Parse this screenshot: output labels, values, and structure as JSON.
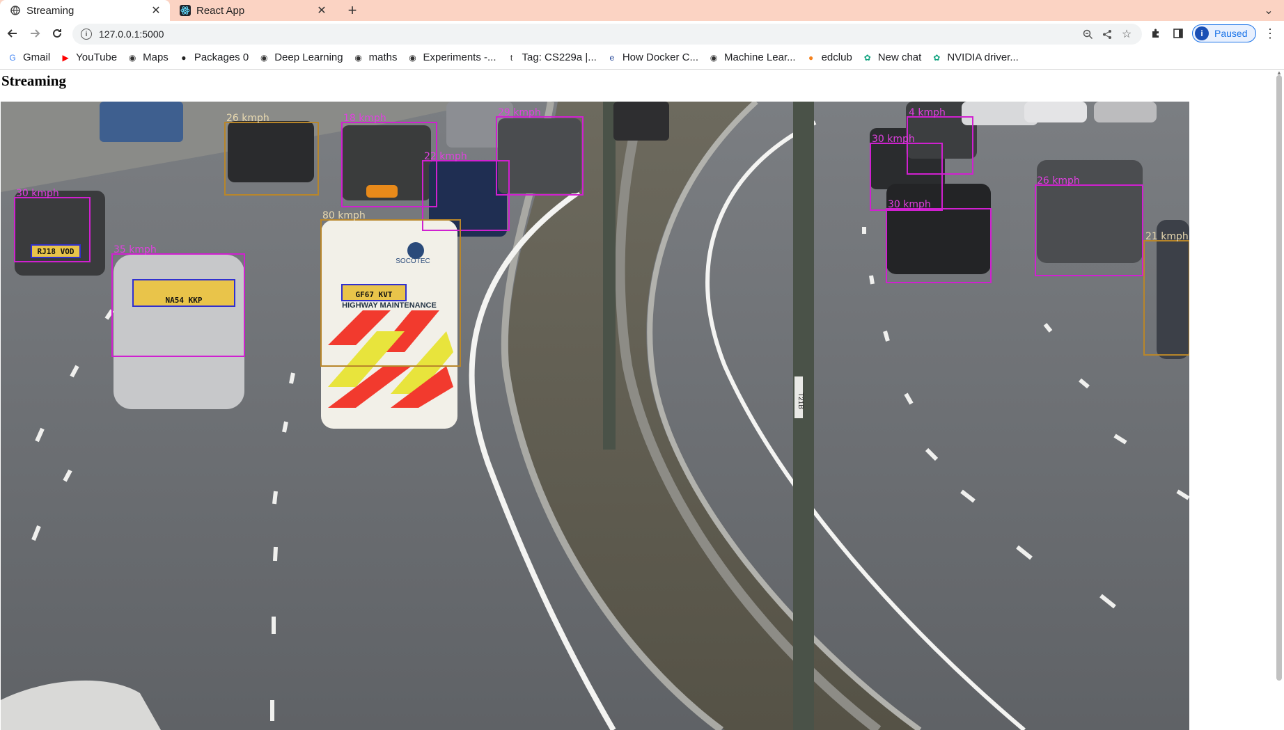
{
  "browser": {
    "tabs": [
      {
        "title": "Streaming",
        "active": true,
        "favicon": "globe-icon"
      },
      {
        "title": "React App",
        "active": false,
        "favicon": "react-icon"
      }
    ],
    "url": "127.0.0.1:5000",
    "profile_label": "Paused",
    "profile_initial": "i"
  },
  "bookmarks": [
    {
      "label": "Gmail",
      "icon": "google-icon",
      "color": "#4285f4"
    },
    {
      "label": "YouTube",
      "icon": "youtube-icon",
      "color": "#ff0000"
    },
    {
      "label": "Maps",
      "icon": "globe-icon",
      "color": "#333333"
    },
    {
      "label": "Packages 0",
      "icon": "github-icon",
      "color": "#222222"
    },
    {
      "label": "Deep Learning",
      "icon": "globe-icon",
      "color": "#333333"
    },
    {
      "label": "maths",
      "icon": "globe-icon",
      "color": "#333333"
    },
    {
      "label": "Experiments -...",
      "icon": "globe-icon",
      "color": "#333333"
    },
    {
      "label": "Tag: CS229a |...",
      "icon": "tag-icon",
      "color": "#333333"
    },
    {
      "label": "How Docker C...",
      "icon": "edx-icon",
      "color": "#1c3f94"
    },
    {
      "label": "Machine Lear...",
      "icon": "globe-icon",
      "color": "#333333"
    },
    {
      "label": "edclub",
      "icon": "edclub-icon",
      "color": "#f5821f"
    },
    {
      "label": "New chat",
      "icon": "openai-icon",
      "color": "#10a37f"
    },
    {
      "label": "NVIDIA driver...",
      "icon": "openai-icon",
      "color": "#10a37f"
    }
  ],
  "page": {
    "heading": "Streaming"
  },
  "stream": {
    "detections": [
      {
        "speed": "30 kmph",
        "plate": "RJ18 VOD",
        "color": "#d020d0"
      },
      {
        "speed": "35 kmph",
        "plate": "NA54 KKP",
        "color": "#d020d0"
      },
      {
        "speed": "26 kmph",
        "plate": "",
        "color": "#b8862a"
      },
      {
        "speed": "18 kmph",
        "plate": "",
        "color": "#d020d0"
      },
      {
        "speed": "22 kmph",
        "plate": "",
        "color": "#d020d0"
      },
      {
        "speed": "29 kmph",
        "plate": "",
        "color": "#d020d0"
      },
      {
        "speed": "80 kmph",
        "plate": "GF67 KVT",
        "color": "#b8862a"
      },
      {
        "speed": "4 kmph",
        "plate": "",
        "color": "#d020d0"
      },
      {
        "speed": "30 kmph",
        "plate": "",
        "color": "#d020d0"
      },
      {
        "speed": "30 kmph",
        "plate": "",
        "color": "#d020d0"
      },
      {
        "speed": "26 kmph",
        "plate": "",
        "color": "#d020d0"
      },
      {
        "speed": "21 kmph",
        "plate": "",
        "color": "#b8862a"
      }
    ],
    "van_text": "HIGHWAY MAINTENANCE",
    "van_brand": "SOCOTEC",
    "pole_marker": "T21B"
  }
}
